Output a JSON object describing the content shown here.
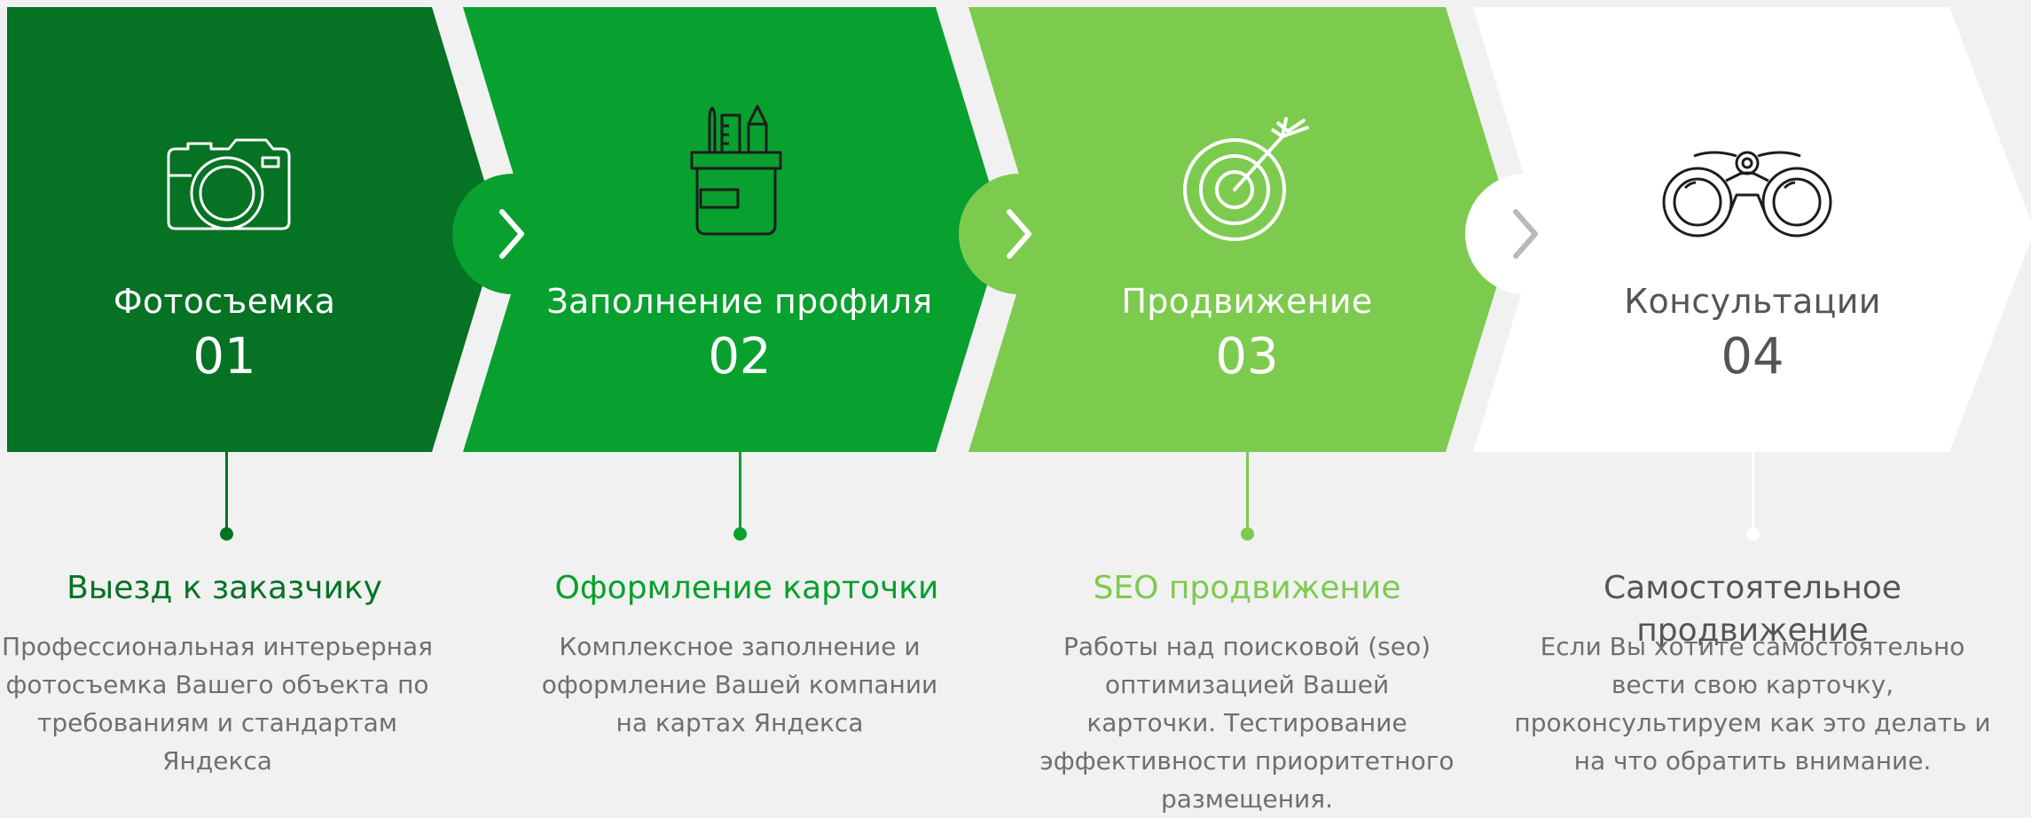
{
  "colors": {
    "background": "#f1f1f1",
    "step1": "#057224",
    "step2": "#08a02e",
    "step3": "#7ccb4e",
    "step4": "#ffffff",
    "light_text": "#ffffff",
    "dark_text": "#555555",
    "body_text": "#6f6f6f",
    "arrow_gray": "#b9b9b9"
  },
  "steps": [
    {
      "title": "Фотосъемка",
      "number": "01",
      "icon": "camera-icon",
      "detail_title": "Выезд к заказчику",
      "detail_text": "Профессиональная интерьерная фотосъемка Вашего объекта по требованиям и стандартам Яндекса"
    },
    {
      "title": "Заполнение профиля",
      "number": "02",
      "icon": "pencil-cup-icon",
      "detail_title": "Оформление карточки",
      "detail_text": "Комплексное заполнение и оформление Вашей компании на картах Яндекса"
    },
    {
      "title": "Продвижение",
      "number": "03",
      "icon": "target-icon",
      "detail_title": "SEO продвижение",
      "detail_text": "Работы над поисковой (seo) оптимизацией Вашей карточки. Тестирование эффективности приоритетного размещения."
    },
    {
      "title": "Консультации",
      "number": "04",
      "icon": "binoculars-icon",
      "detail_title": "Самостоятельное продвижение",
      "detail_text": "Если Вы хотите самостоятельно вести свою карточку, проконсультируем как это делать и на что обратить внимание."
    }
  ],
  "arrows": [
    "chevron-right-icon",
    "chevron-right-icon",
    "chevron-right-icon"
  ]
}
